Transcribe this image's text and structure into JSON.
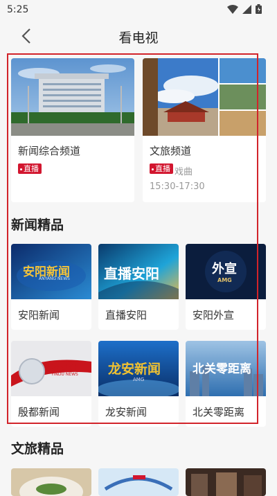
{
  "status_bar": {
    "time": "5:25"
  },
  "header": {
    "title": "看电视"
  },
  "channels": [
    {
      "name": "新闻综合频道",
      "badge": "直播"
    },
    {
      "name": "文旅频道",
      "badge": "直播",
      "program": "戏曲",
      "time": "15:30-17:30"
    }
  ],
  "news_section": {
    "title": "新闻精品",
    "items": [
      {
        "label": "安阳新闻",
        "thumb_text": "安阳新闻",
        "thumb_sub": "ANYANG NEWS"
      },
      {
        "label": "直播安阳",
        "thumb_text": "直播安阳"
      },
      {
        "label": "安阳外宣",
        "thumb_text": "外宣",
        "thumb_sub": "AMG"
      },
      {
        "label": "殷都新闻",
        "thumb_text": "殷都新闻",
        "thumb_sub": "YINDU NEWS"
      },
      {
        "label": "龙安新闻",
        "thumb_text": "龙安新闻",
        "thumb_sub": "AMG"
      },
      {
        "label": "北关零距离",
        "thumb_text": "北关零距离"
      }
    ]
  },
  "culture_section": {
    "title": "文旅精品"
  },
  "colors": {
    "accent": "#d2162f",
    "selection": "#d2232a"
  }
}
